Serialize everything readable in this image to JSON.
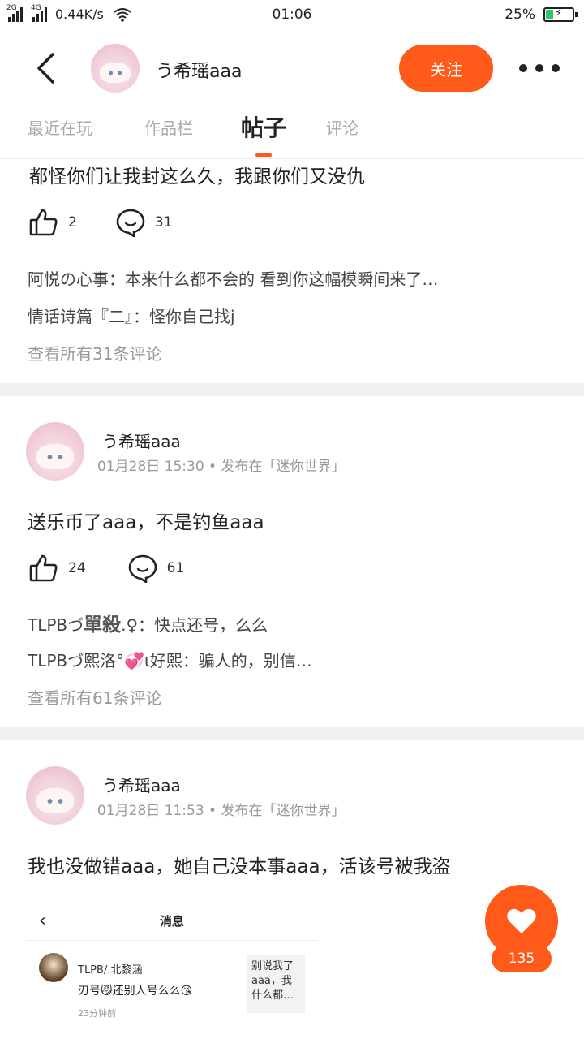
{
  "status_bar": {
    "net1": "2G",
    "net2": "4G",
    "speed": "0.44K/s",
    "time": "01:06",
    "battery": "25%",
    "battery_level": 0.25
  },
  "header": {
    "name": "う希瑶aaa",
    "follow_label": "关注"
  },
  "tabs": [
    {
      "label": "最近在玩"
    },
    {
      "label": "作品栏"
    },
    {
      "label": "帖子"
    },
    {
      "label": "评论"
    }
  ],
  "posts": [
    {
      "text": "都怪你们让我封这么久，我跟你们又没仇",
      "likes": "2",
      "comments": "31",
      "comment_lines": [
        {
          "author": "阿悦の心事",
          "text": "：本来什么都不会的 看到你这幅模瞬间来了…"
        },
        {
          "author": "情话诗篇『二』",
          "text": "：怪你自己找j"
        }
      ],
      "view_all": "查看所有31条评论"
    },
    {
      "author": "う希瑶aaa",
      "meta": "01月28日 15:30 • 发布在「迷你世界」",
      "text": "送乐币了aaa，不是钓鱼aaa",
      "likes": "24",
      "comments": "61",
      "comment_lines": [
        {
          "author_prefix": "TLPBづ",
          "author_bold": "單殺",
          "author_suffix": ".♀",
          "text": "：快点还号，么么"
        },
        {
          "author": "TLPBづ熙洛°💞ι好熙",
          "text": "：骗人的，别信…"
        }
      ],
      "view_all": "查看所有61条评论"
    },
    {
      "author": "う希瑶aaa",
      "meta": "01月28日 11:53 • 发布在「迷你世界」",
      "text": "我也没做错aaa，她自己没本事aaa，活该号被我盗"
    }
  ],
  "embed": {
    "title": "消息",
    "sender": "TLPB/.北黎涵",
    "message": "刃号😼还别人号么么😘",
    "time": "23分钟前",
    "preview": "别说我了aaa，我什么都…"
  },
  "fab": {
    "count": "135"
  },
  "colors": {
    "accent": "#ff5a1a",
    "battery_fill": "#2ec86a"
  }
}
